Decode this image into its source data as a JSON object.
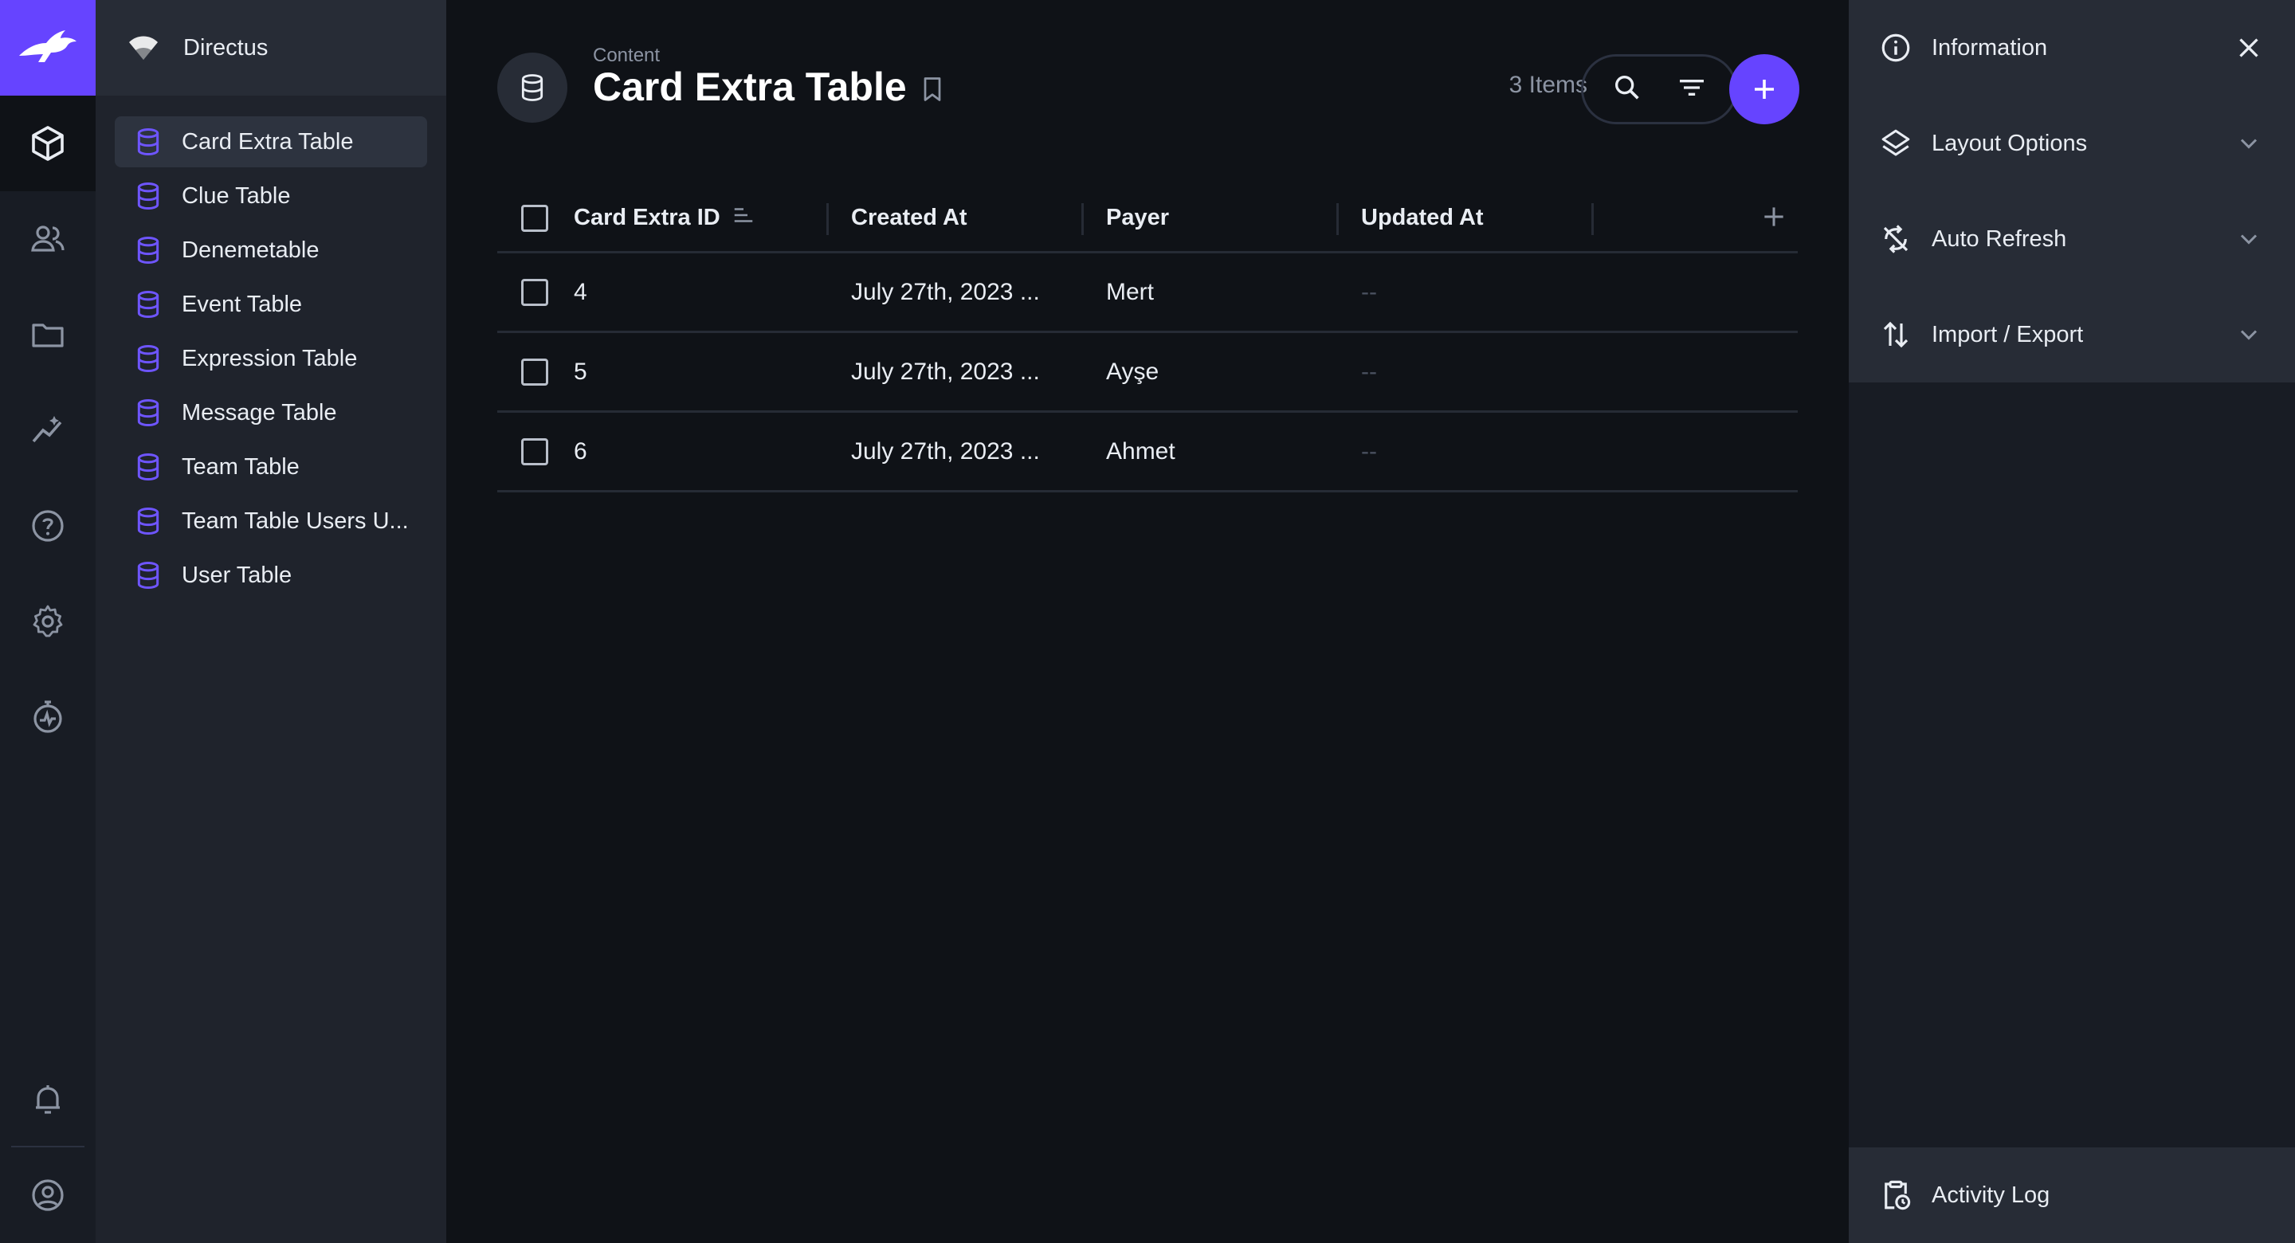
{
  "project": {
    "name": "Directus"
  },
  "nav": {
    "items": [
      {
        "label": "Card Extra Table",
        "active": true
      },
      {
        "label": "Clue Table"
      },
      {
        "label": "Denemetable"
      },
      {
        "label": "Event Table"
      },
      {
        "label": "Expression Table"
      },
      {
        "label": "Message Table"
      },
      {
        "label": "Team Table"
      },
      {
        "label": "Team Table Users U..."
      },
      {
        "label": "User Table"
      }
    ]
  },
  "header": {
    "breadcrumb": "Content",
    "title": "Card Extra Table",
    "item_count": "3 Items"
  },
  "table": {
    "columns": [
      "Card Extra ID",
      "Created At",
      "Payer",
      "Updated At"
    ],
    "rows": [
      [
        "4",
        "July 27th, 2023 ...",
        "Mert",
        "--"
      ],
      [
        "5",
        "July 27th, 2023 ...",
        "Ayşe",
        "--"
      ],
      [
        "6",
        "July 27th, 2023 ...",
        "Ahmet",
        "--"
      ]
    ]
  },
  "sidebar": {
    "information": "Information",
    "layout_options": "Layout Options",
    "auto_refresh": "Auto Refresh",
    "import_export": "Import / Export",
    "activity_log": "Activity Log"
  },
  "colors": {
    "accent": "#6644ff",
    "background": "#0f1217",
    "nav": "#1f232c"
  },
  "icons": [
    "rabbit-logo-icon",
    "cube-icon",
    "users-icon",
    "folder-icon",
    "insights-icon",
    "help-icon",
    "settings-icon",
    "timer-icon",
    "bell-icon",
    "account-icon",
    "database-icon",
    "bookmark-icon",
    "search-icon",
    "filter-icon",
    "plus-icon",
    "info-icon",
    "close-icon",
    "layers-icon",
    "sync-off-icon",
    "import-export-icon",
    "chevron-down-icon",
    "activity-log-icon"
  ]
}
